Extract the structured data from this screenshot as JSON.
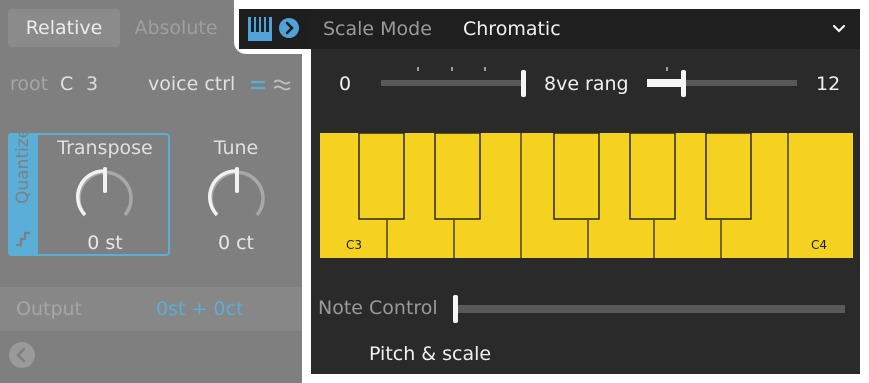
{
  "left_panel": {
    "mode_relative": "Relative",
    "mode_absolute": "Absolute",
    "root_label": "root",
    "root_note": "C",
    "root_octave": "3",
    "voice_ctrl_label": "voice ctrl",
    "quantize_label": "Quantize",
    "transpose_title": "Transpose",
    "transpose_value": "0 st",
    "tune_title": "Tune",
    "tune_value": "0 ct",
    "output_label": "Output",
    "output_value": "0st + 0ct",
    "back_icon": "chevron-left-icon"
  },
  "header": {
    "piano_icon": "piano-keys-icon",
    "arrow_icon": "arrow-right-circle-icon",
    "scale_mode_label": "Scale Mode",
    "scale_mode_value": "Chromatic",
    "dropdown_icon": "chevron-down-icon"
  },
  "range": {
    "min": "0",
    "max": "12",
    "label": "8ve rang"
  },
  "keyboard": {
    "low_label": "C3",
    "high_label": "C4",
    "key_color": "#f5d21f"
  },
  "note_control": {
    "label": "Note Control",
    "value": 0
  },
  "footer": {
    "title": "Pitch & scale"
  },
  "colors": {
    "accent": "#5aaed8",
    "panel": "#2a2a2a",
    "dimmed_panel": "#7f7f7f"
  }
}
